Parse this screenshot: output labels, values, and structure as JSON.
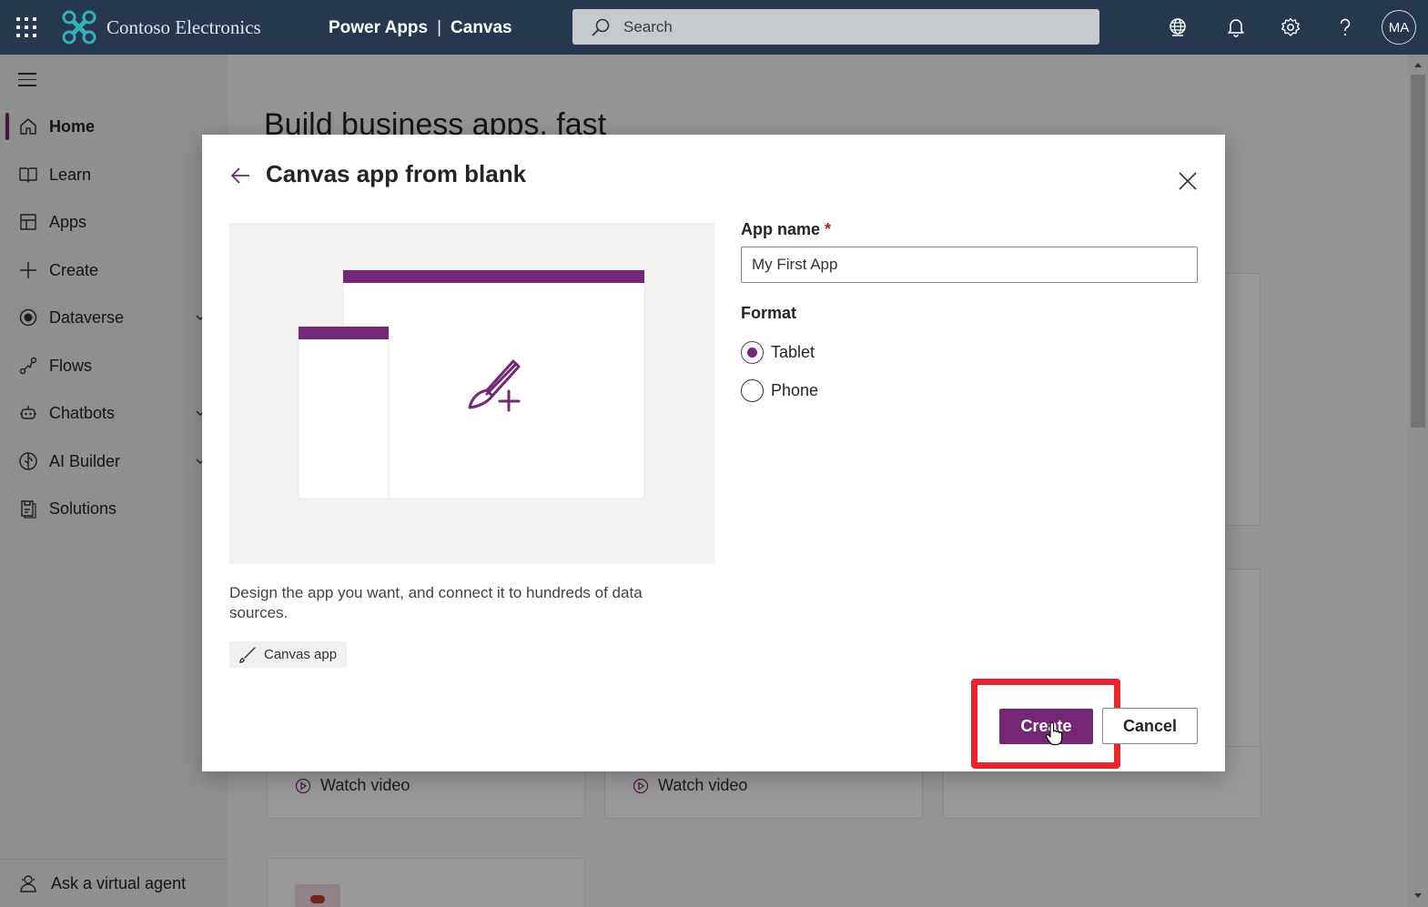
{
  "topbar": {
    "brand": "Contoso Electronics",
    "product": "Power Apps",
    "separator": "|",
    "context": "Canvas",
    "search_placeholder": "Search",
    "avatar_initials": "MA",
    "background_color": "#253850"
  },
  "sidebar": {
    "items": [
      {
        "label": "Home",
        "icon": "home-icon",
        "active": true
      },
      {
        "label": "Learn",
        "icon": "book-icon"
      },
      {
        "label": "Apps",
        "icon": "apps-icon"
      },
      {
        "label": "Create",
        "icon": "plus-icon"
      },
      {
        "label": "Dataverse",
        "icon": "dataverse-icon",
        "expandable": true
      },
      {
        "label": "Flows",
        "icon": "flow-icon"
      },
      {
        "label": "Chatbots",
        "icon": "chatbot-icon",
        "expandable": true
      },
      {
        "label": "AI Builder",
        "icon": "ai-builder-icon",
        "expandable": true
      },
      {
        "label": "Solutions",
        "icon": "solutions-icon"
      }
    ],
    "virtual_agent": "Ask a virtual agent"
  },
  "main": {
    "heading": "Build business apps, fast",
    "watch_video_1": "Watch video",
    "watch_video_2": "Watch video"
  },
  "dialog": {
    "title": "Canvas app from blank",
    "description": "Design the app you want, and connect it to hundreds of data sources.",
    "tag_label": "Canvas app",
    "app_name_label": "App name",
    "required_marker": "*",
    "app_name_value": "My First App",
    "format_label": "Format",
    "format_options": [
      {
        "label": "Tablet",
        "selected": true
      },
      {
        "label": "Phone",
        "selected": false
      }
    ],
    "create_label": "Create",
    "cancel_label": "Cancel",
    "accent_color": "#742774",
    "highlight_color": "#e8252e"
  }
}
